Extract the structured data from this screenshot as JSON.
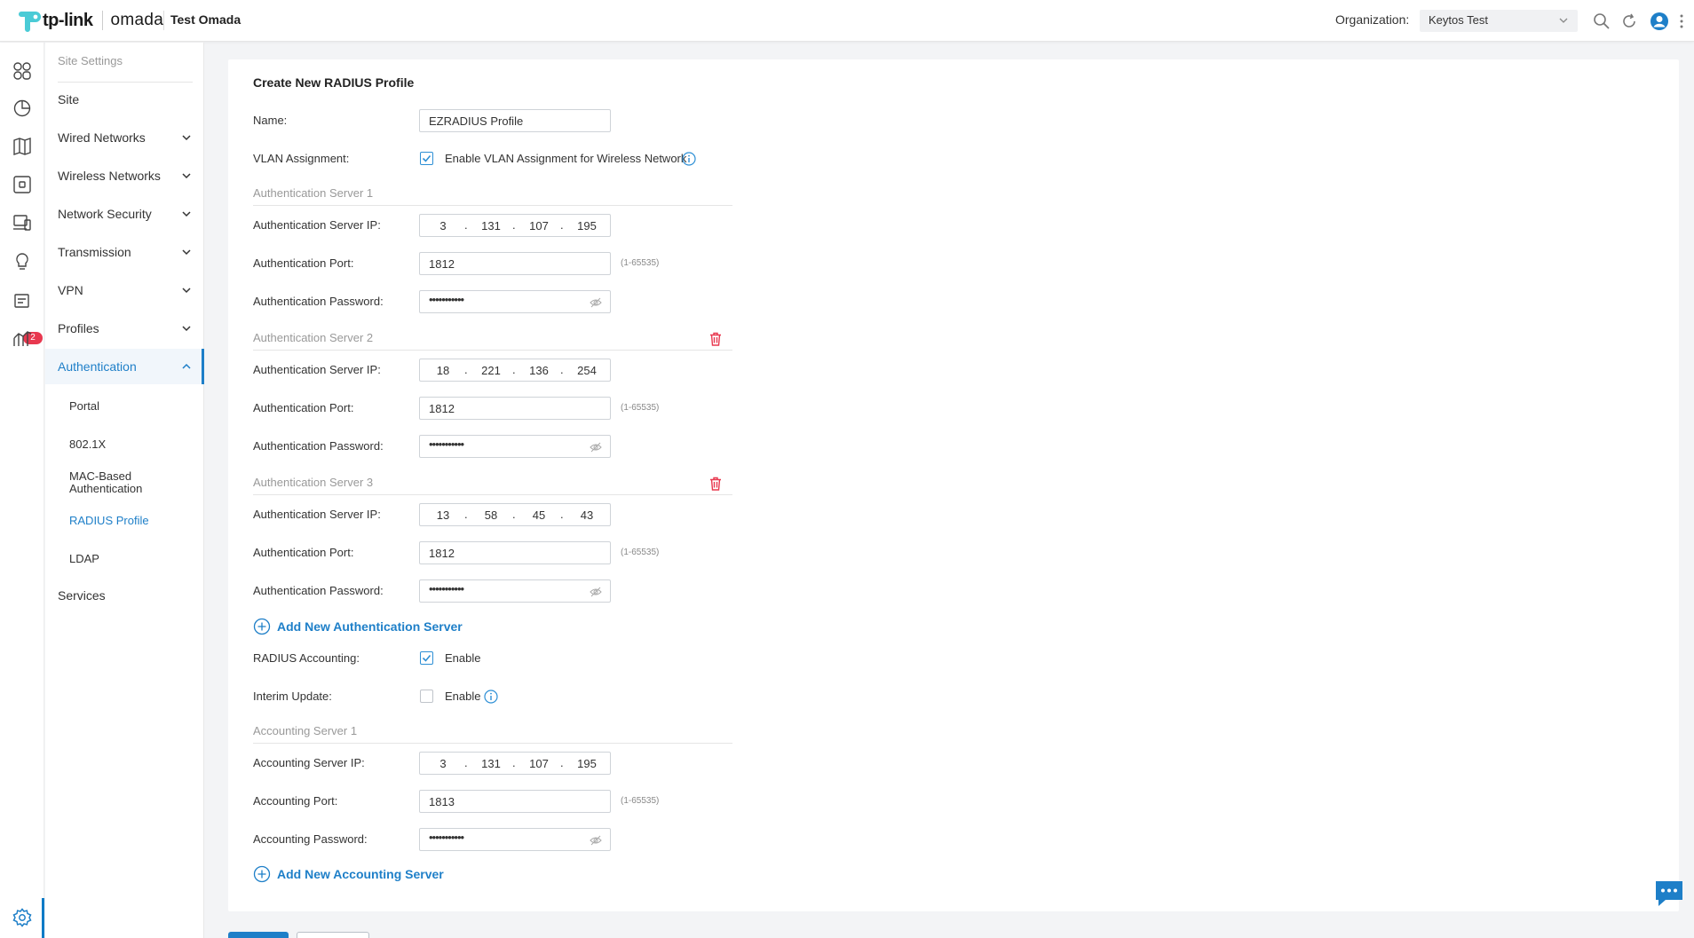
{
  "header": {
    "brand": "tp-link",
    "product": "omada",
    "site_name": "Test Omada",
    "org_label": "Organization:",
    "org_value": "Keytos Test"
  },
  "rail": {
    "badge_count": "2",
    "icons": [
      "dashboard-icon",
      "statistics-icon",
      "map-icon",
      "devices-icon",
      "clients-icon",
      "insights-icon",
      "logs-icon",
      "reports-icon",
      "settings-icon"
    ]
  },
  "sidebar": {
    "heading": "Site Settings",
    "items": [
      {
        "label": "Site"
      },
      {
        "label": "Wired Networks"
      },
      {
        "label": "Wireless Networks"
      },
      {
        "label": "Network Security"
      },
      {
        "label": "Transmission"
      },
      {
        "label": "VPN"
      },
      {
        "label": "Profiles"
      },
      {
        "label": "Authentication"
      }
    ],
    "auth_children": [
      {
        "label": "Portal"
      },
      {
        "label": "802.1X"
      },
      {
        "label": "MAC-Based"
      },
      {
        "label": "Authentication"
      },
      {
        "label": "RADIUS Profile"
      },
      {
        "label": "LDAP"
      }
    ],
    "services": "Services"
  },
  "form": {
    "title": "Create New RADIUS Profile",
    "name_label": "Name:",
    "name_value": "EZRADIUS Profile",
    "vlan_label": "VLAN Assignment:",
    "vlan_checkbox_label": "Enable VLAN Assignment for Wireless Network",
    "auth_servers": [
      {
        "title": "Authentication Server 1",
        "ip_label": "Authentication Server IP:",
        "ip": [
          "3",
          "131",
          "107",
          "195"
        ],
        "port_label": "Authentication Port:",
        "port": "1812",
        "range": "(1-65535)",
        "password_label": "Authentication Password:",
        "password": "•••••••••••"
      },
      {
        "title": "Authentication Server 2",
        "ip_label": "Authentication Server IP:",
        "ip": [
          "18",
          "221",
          "136",
          "254"
        ],
        "port_label": "Authentication Port:",
        "port": "1812",
        "range": "(1-65535)",
        "password_label": "Authentication Password:",
        "password": "•••••••••••"
      },
      {
        "title": "Authentication Server 3",
        "ip_label": "Authentication Server IP:",
        "ip": [
          "13",
          "58",
          "45",
          "43"
        ],
        "port_label": "Authentication Port:",
        "port": "1812",
        "range": "(1-65535)",
        "password_label": "Authentication Password:",
        "password": "•••••••••••"
      }
    ],
    "add_auth_server": "Add New Authentication Server",
    "radius_accounting_label": "RADIUS Accounting:",
    "radius_accounting_checkbox": "Enable",
    "interim_update_label": "Interim Update:",
    "interim_update_checkbox": "Enable",
    "accounting_server": {
      "title": "Accounting Server 1",
      "ip_label": "Accounting Server IP:",
      "ip": [
        "3",
        "131",
        "107",
        "195"
      ],
      "port_label": "Accounting Port:",
      "port": "1813",
      "range": "(1-65535)",
      "password_label": "Accounting Password:",
      "password": "•••••••••••"
    },
    "add_accounting_server": "Add New Accounting Server"
  },
  "colors": {
    "accent": "#1e7fc8",
    "danger": "#e8384f",
    "brand_teal": "#4acbd6"
  }
}
